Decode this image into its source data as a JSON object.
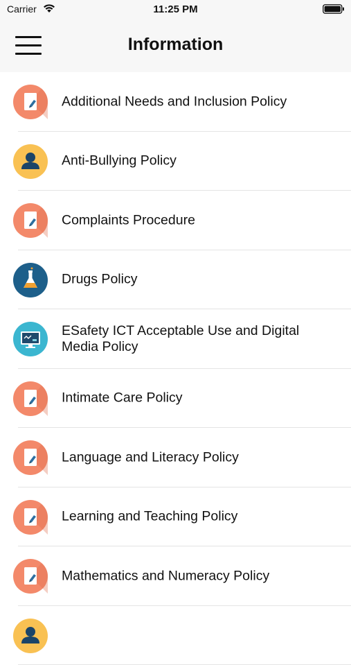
{
  "status_bar": {
    "carrier": "Carrier",
    "time": "11:25 PM"
  },
  "header": {
    "title": "Information"
  },
  "colors": {
    "doc": "#f3896a",
    "person": "#f9c153",
    "flask": "#1d5f8a",
    "monitor": "#3bb6d0"
  },
  "items": [
    {
      "label": "Additional Needs and Inclusion Policy",
      "icon": "document-icon"
    },
    {
      "label": "Anti-Bullying Policy",
      "icon": "person-icon"
    },
    {
      "label": "Complaints Procedure",
      "icon": "document-icon"
    },
    {
      "label": "Drugs Policy",
      "icon": "flask-icon"
    },
    {
      "label": "ESafety ICT Acceptable Use and Digital Media Policy",
      "icon": "monitor-icon"
    },
    {
      "label": "Intimate Care Policy",
      "icon": "document-icon"
    },
    {
      "label": "Language and Literacy Policy",
      "icon": "document-icon"
    },
    {
      "label": "Learning and Teaching Policy",
      "icon": "document-icon"
    },
    {
      "label": "Mathematics and Numeracy Policy",
      "icon": "document-icon"
    },
    {
      "label": "",
      "icon": "person-icon"
    }
  ]
}
